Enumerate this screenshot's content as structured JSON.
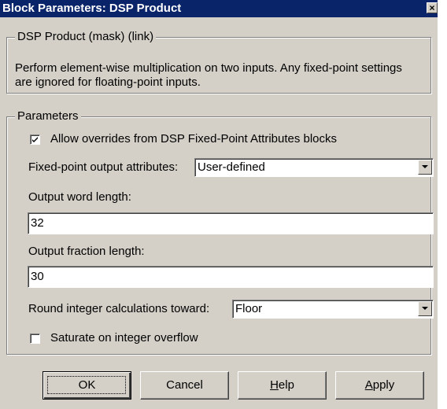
{
  "window": {
    "title": "Block Parameters: DSP Product",
    "close_glyph": "×"
  },
  "description_group": {
    "legend": "DSP Product (mask) (link)",
    "line1": "Perform element-wise multiplication on two inputs. Any fixed-point settings",
    "line2": "are ignored for floating-point inputs."
  },
  "parameters_group": {
    "legend": "Parameters",
    "allow_overrides": {
      "label": "Allow overrides from DSP Fixed-Point Attributes blocks",
      "checked": true
    },
    "fixed_point_output": {
      "label": "Fixed-point output attributes:",
      "value": "User-defined"
    },
    "output_word_length": {
      "label": "Output word length:",
      "value": "32"
    },
    "output_fraction_length": {
      "label": "Output fraction length:",
      "value": "30"
    },
    "round_integer": {
      "label": "Round integer calculations toward:",
      "value": "Floor"
    },
    "saturate": {
      "label": "Saturate on integer overflow",
      "checked": false
    }
  },
  "buttons": {
    "ok": "OK",
    "cancel": "Cancel",
    "help_underline": "H",
    "help_rest": "elp",
    "apply_underline": "A",
    "apply_rest": "pply"
  },
  "icons": {
    "close": "close-icon",
    "check": "check-icon",
    "dropdown": "chevron-down-icon"
  }
}
